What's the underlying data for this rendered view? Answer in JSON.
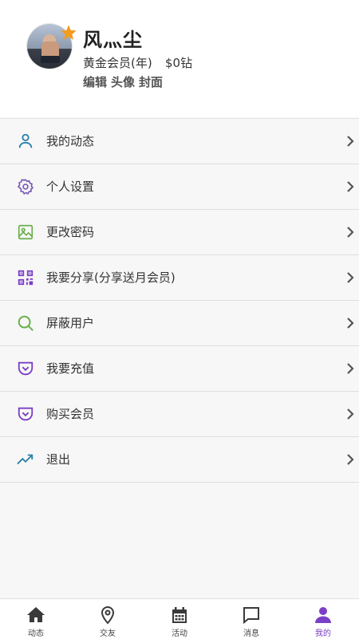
{
  "profile": {
    "name": "风灬尘",
    "level": "黄金会员(年)",
    "coins": "$0钻",
    "links": [
      "编辑",
      "头像",
      "封面"
    ]
  },
  "menu": [
    {
      "label": "我的动态",
      "icon": "person-icon",
      "color": "#2a7fa8"
    },
    {
      "label": "个人设置",
      "icon": "gear-icon",
      "color": "#7a5bb8"
    },
    {
      "label": "更改密码",
      "icon": "image-icon",
      "color": "#6ab04c"
    },
    {
      "label": "我要分享(分享送月会员)",
      "icon": "qrcode-icon",
      "color": "#7a3fc6"
    },
    {
      "label": "屏蔽用户",
      "icon": "search-icon",
      "color": "#6ab04c"
    },
    {
      "label": "我要充值",
      "icon": "pocket-icon",
      "color": "#7a3fc6"
    },
    {
      "label": "购买会员",
      "icon": "pocket-icon",
      "color": "#7a3fc6"
    },
    {
      "label": "退出",
      "icon": "trending-up-icon",
      "color": "#2a7fa8"
    }
  ],
  "tabs": [
    {
      "label": "动态",
      "icon": "home-icon"
    },
    {
      "label": "交友",
      "icon": "location-pin-icon"
    },
    {
      "label": "活动",
      "icon": "calendar-icon"
    },
    {
      "label": "消息",
      "icon": "chat-icon"
    },
    {
      "label": "我的",
      "icon": "user-icon",
      "active": true
    }
  ],
  "colors": {
    "accent": "#7a3fc6",
    "star": "#f39c1f"
  }
}
